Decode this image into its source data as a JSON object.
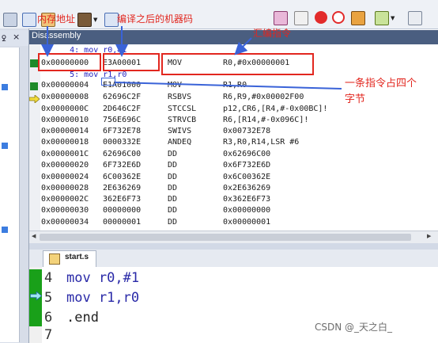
{
  "toolbar": {
    "icons": [
      "hex-icon",
      "stack-icon",
      "memory-icon",
      "stop-icon",
      "window-icon",
      "breakpoint-icon",
      "circle-icon",
      "settings-icon",
      "view-icon",
      "zoom-icon"
    ]
  },
  "disassembly": {
    "title": "Disassembly",
    "lines": [
      {
        "kind": "src",
        "text": "      4: mov r0,#1"
      },
      {
        "kind": "asm",
        "addr": "0x00000000",
        "code": "E3A00001",
        "mnem": "MOV",
        "ops": "R0,#0x00000001"
      },
      {
        "kind": "src",
        "text": "      5: mov r1,r0"
      },
      {
        "kind": "asm",
        "addr": "0x00000004",
        "code": "E1A01000",
        "mnem": "MOV",
        "ops": "R1,R0"
      },
      {
        "kind": "asm",
        "addr": "0x00000008",
        "code": "62696C2F",
        "mnem": "RSBVS",
        "ops": "R6,R9,#0x00002F00"
      },
      {
        "kind": "asm",
        "addr": "0x0000000C",
        "code": "2D646C2F",
        "mnem": "STCCSL",
        "ops": "p12,CR6,[R4,#-0x00BC]!"
      },
      {
        "kind": "asm",
        "addr": "0x00000010",
        "code": "756E696C",
        "mnem": "STRVCB",
        "ops": "R6,[R14,#-0x096C]!"
      },
      {
        "kind": "asm",
        "addr": "0x00000014",
        "code": "6F732E78",
        "mnem": "SWIVS",
        "ops": "0x00732E78"
      },
      {
        "kind": "asm",
        "addr": "0x00000018",
        "code": "0000332E",
        "mnem": "ANDEQ",
        "ops": "R3,R0,R14,LSR #6"
      },
      {
        "kind": "asm",
        "addr": "0x0000001C",
        "code": "62696C00",
        "mnem": "DD",
        "ops": "0x62696C00"
      },
      {
        "kind": "asm",
        "addr": "0x00000020",
        "code": "6F732E6D",
        "mnem": "DD",
        "ops": "0x6F732E6D"
      },
      {
        "kind": "asm",
        "addr": "0x00000024",
        "code": "6C00362E",
        "mnem": "DD",
        "ops": "0x6C00362E"
      },
      {
        "kind": "asm",
        "addr": "0x00000028",
        "code": "2E636269",
        "mnem": "DD",
        "ops": "0x2E636269"
      },
      {
        "kind": "asm",
        "addr": "0x0000002C",
        "code": "362E6F73",
        "mnem": "DD",
        "ops": "0x362E6F73"
      },
      {
        "kind": "asm",
        "addr": "0x00000030",
        "code": "00000000",
        "mnem": "DD",
        "ops": "0x00000000"
      },
      {
        "kind": "asm",
        "addr": "0x00000034",
        "code": "00000001",
        "mnem": "DD",
        "ops": "0x00000001"
      }
    ]
  },
  "editor": {
    "tab_label": "start.s",
    "lines": [
      {
        "num": "4",
        "code": "mov r0,#1"
      },
      {
        "num": "5",
        "code": "mov r1,r0"
      },
      {
        "num": "6",
        "code": ".end"
      },
      {
        "num": "7",
        "code": ""
      }
    ]
  },
  "annotations": {
    "memory_address": "内存地址",
    "machine_code": "编译之后的机器码",
    "assembly_instruction": "汇编指令",
    "instruction_size_line1": "一条指令占四个",
    "instruction_size_line2": "字节"
  },
  "watermark": "CSDN @_天之白_",
  "colors": {
    "annotation_red": "#e2271f",
    "annotation_blue": "#3a63d8",
    "title_bar": "#4a5e80",
    "breakpoint_green": "#1d8a2a",
    "source_blue": "#1f1fbf"
  }
}
